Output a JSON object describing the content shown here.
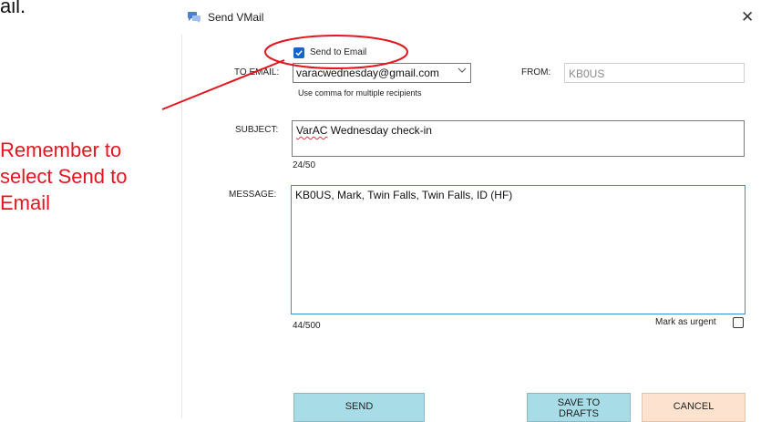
{
  "page_fragment": "ail.",
  "window": {
    "title": "Send VMail",
    "close_glyph": "✕"
  },
  "form": {
    "send_to_email_label": "Send to Email",
    "send_to_email_checked": true,
    "to_email_label": "TO EMAIL:",
    "to_email_value": "varacwednesday@gmail.com",
    "to_email_hint": "Use comma for multiple recipients",
    "from_label": "FROM:",
    "from_value": "KB0US",
    "subject_label": "SUBJECT:",
    "subject_value_word1": "VarAC",
    "subject_value_rest": " Wednesday check-in",
    "subject_count": "24/50",
    "message_label": "MESSAGE:",
    "message_value": "KB0US, Mark, Twin Falls, Twin Falls, ID (HF)",
    "message_count": "44/500",
    "urgent_label": "Mark as urgent",
    "urgent_checked": false
  },
  "buttons": {
    "send": "SEND",
    "drafts_line1": "SAVE TO",
    "drafts_line2": "DRAFTS",
    "cancel": "CANCEL"
  },
  "annotation": {
    "text": "Remember to\nselect Send to\nEmail",
    "color": "#e3161f"
  },
  "colors": {
    "checkbox_accent": "#1566c9",
    "button_blue": "#a8dce6",
    "button_peach": "#fde3cf",
    "focus_border": "#3a8fd6"
  },
  "icons": {
    "title_icon": "chat-bubbles-icon",
    "checkmark": "check-icon",
    "dropdown": "chevron-down-icon"
  }
}
